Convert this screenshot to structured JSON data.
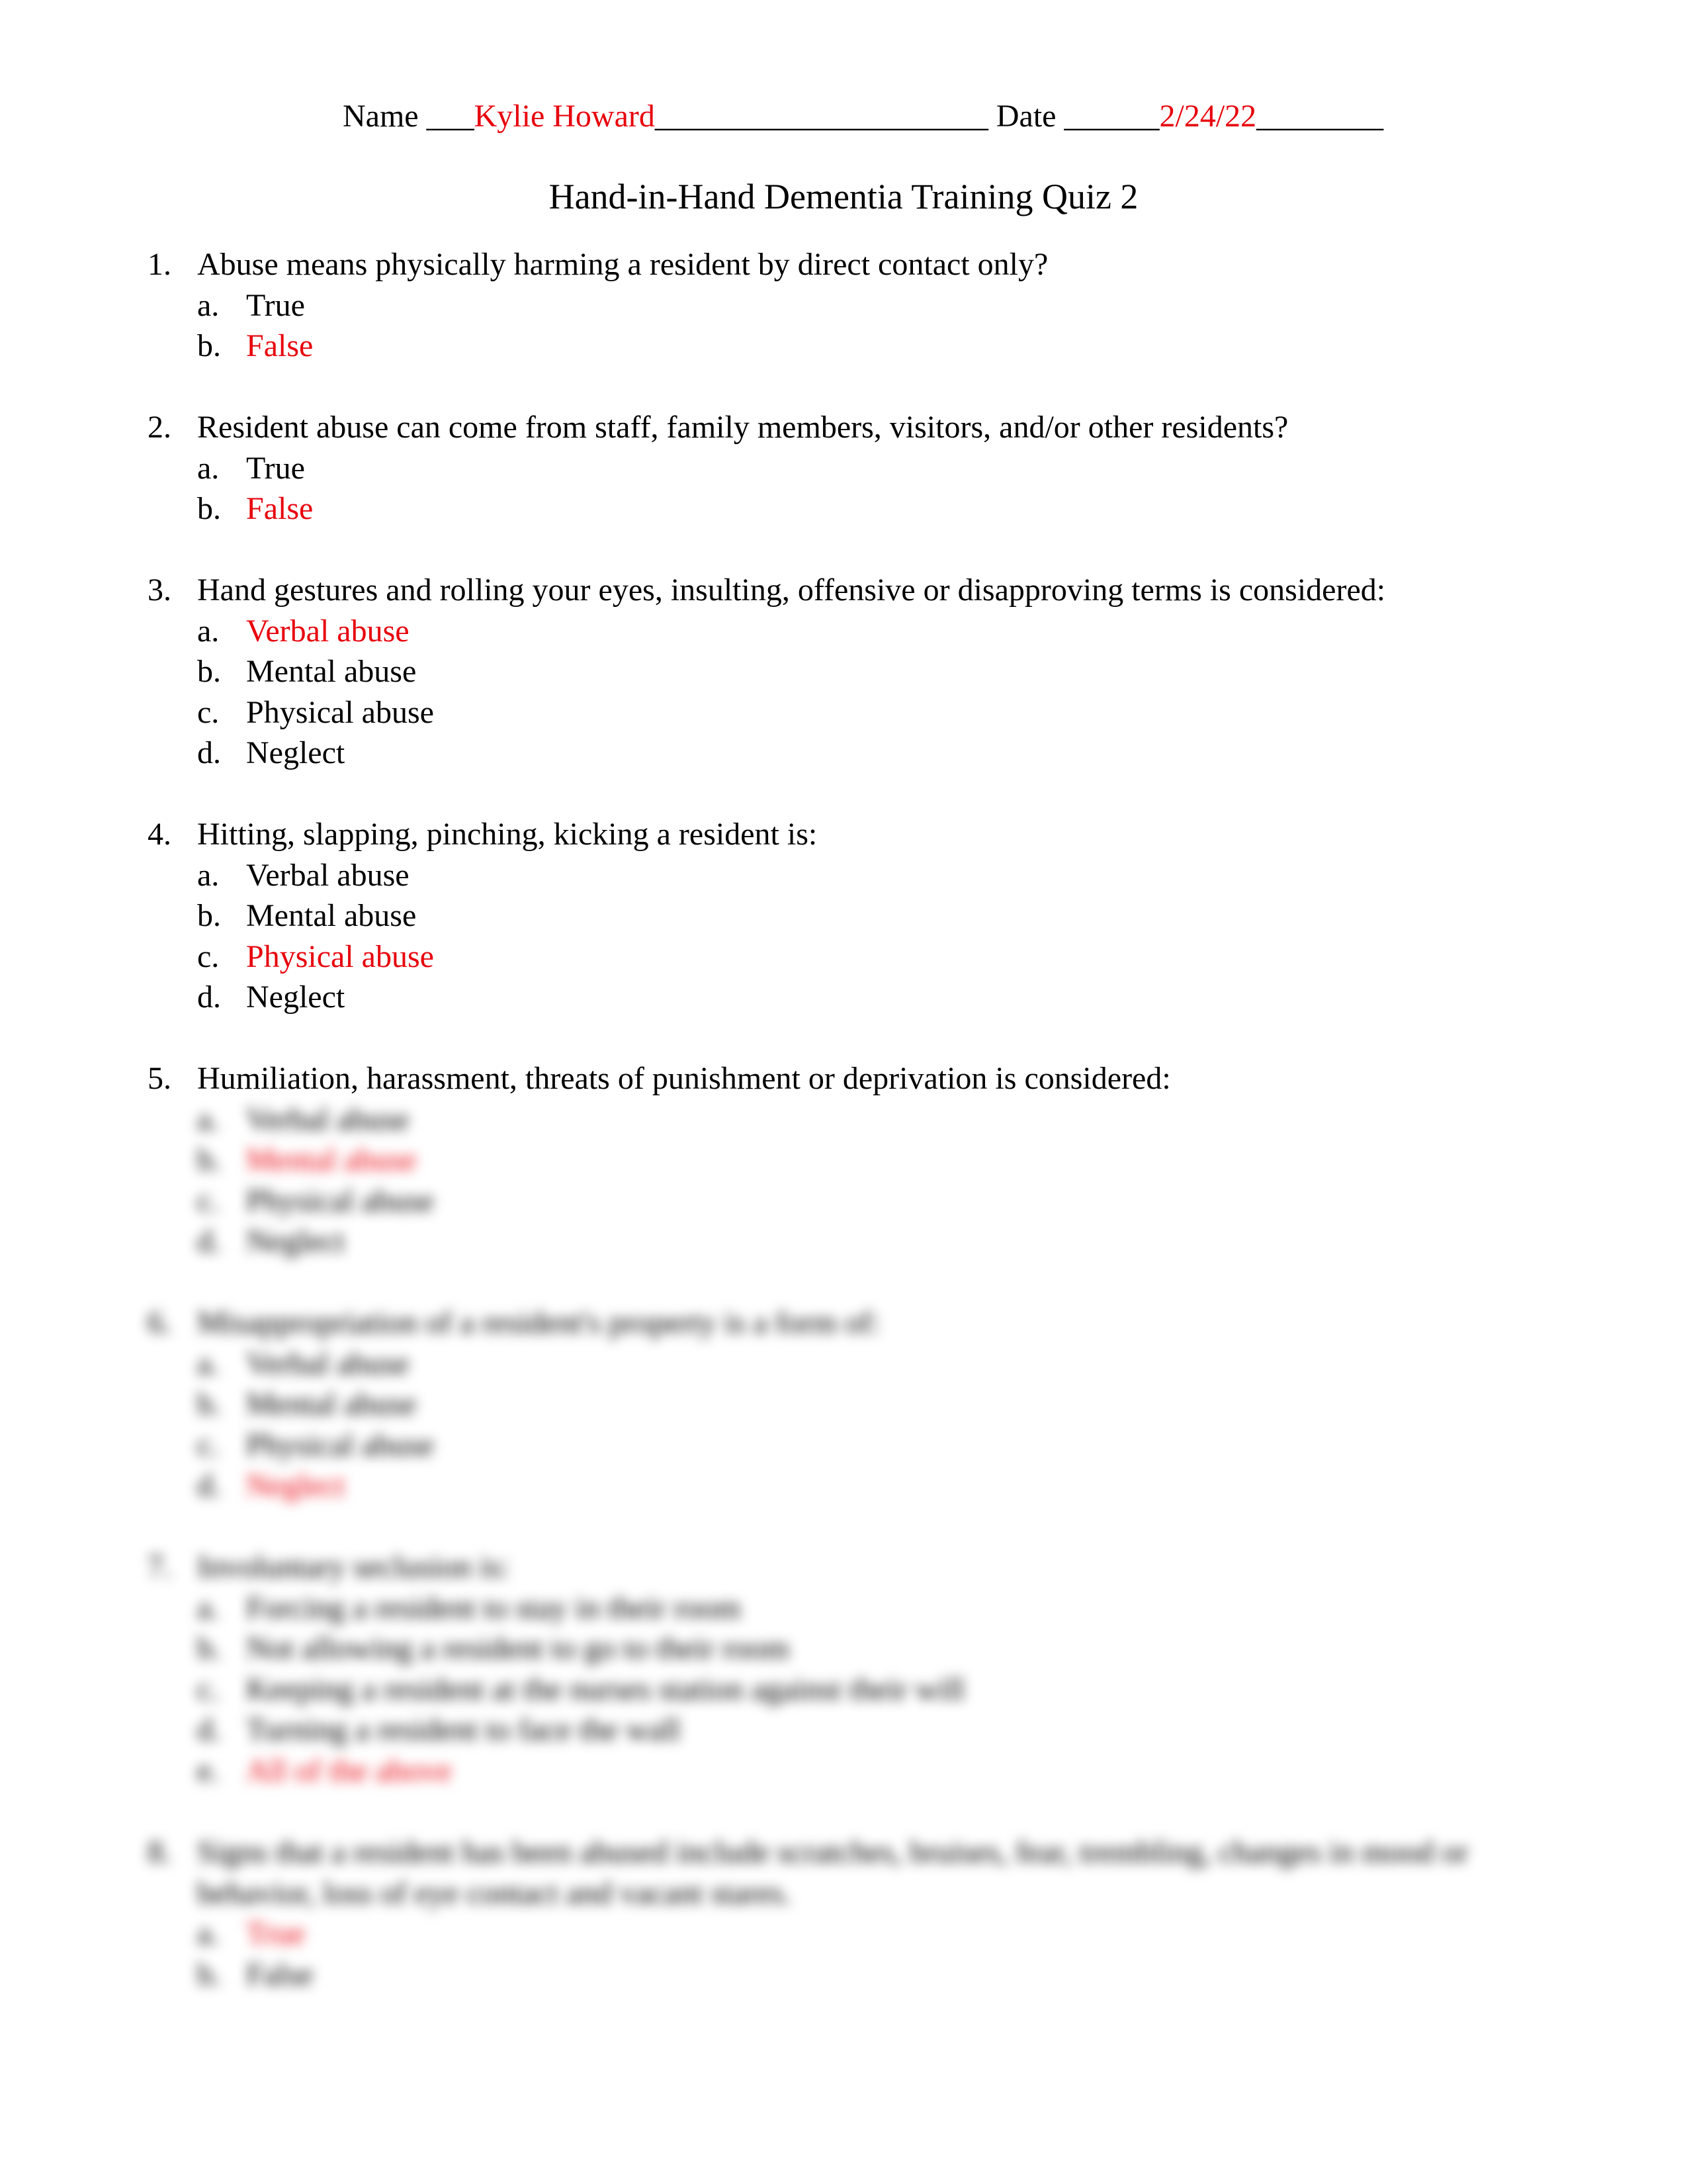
{
  "header": {
    "name_label": "Name ___",
    "name_value": "Kylie Howard",
    "name_trailing": "_____________________",
    "date_label": " Date ______",
    "date_value": "2/24/22",
    "date_trailing": "________"
  },
  "title": "Hand-in-Hand Dementia Training Quiz 2",
  "colors": {
    "answer": "#e8000b",
    "text": "#000000"
  },
  "questions": [
    {
      "number": "1.",
      "text": "Abuse means physically harming a resident by direct contact only?",
      "options": [
        {
          "letter": "a.",
          "text": "True",
          "marked": false
        },
        {
          "letter": "b.",
          "text": "False",
          "marked": true
        }
      ]
    },
    {
      "number": "2.",
      "text": "Resident abuse can come from staff, family members, visitors, and/or other residents?",
      "options": [
        {
          "letter": "a.",
          "text": "True",
          "marked": false
        },
        {
          "letter": "b.",
          "text": "False",
          "marked": true
        }
      ]
    },
    {
      "number": "3.",
      "text": "Hand gestures and rolling your eyes, insulting, offensive or disapproving terms is considered:",
      "options": [
        {
          "letter": "a.",
          "text": "Verbal abuse",
          "marked": true
        },
        {
          "letter": "b.",
          "text": "Mental abuse",
          "marked": false
        },
        {
          "letter": "c.",
          "text": "Physical abuse",
          "marked": false
        },
        {
          "letter": "d.",
          "text": "Neglect",
          "marked": false
        }
      ]
    },
    {
      "number": "4.",
      "text": "Hitting, slapping, pinching, kicking a resident is:",
      "options": [
        {
          "letter": "a.",
          "text": "Verbal abuse",
          "marked": false
        },
        {
          "letter": "b.",
          "text": "Mental abuse",
          "marked": false
        },
        {
          "letter": "c.",
          "text": "Physical abuse",
          "marked": true
        },
        {
          "letter": "d.",
          "text": "Neglect",
          "marked": false
        }
      ]
    },
    {
      "number": "5.",
      "text": "Humiliation, harassment, threats of punishment or deprivation is considered:",
      "options": [
        {
          "letter": "a.",
          "text": "Verbal abuse",
          "marked": false
        },
        {
          "letter": "b.",
          "text": "Mental abuse",
          "marked": true
        },
        {
          "letter": "c.",
          "text": "Physical abuse",
          "marked": false
        },
        {
          "letter": "d.",
          "text": "Neglect",
          "marked": false
        }
      ]
    },
    {
      "number": "6.",
      "text": "Misappropriation of a resident's property is a form of:",
      "options": [
        {
          "letter": "a.",
          "text": "Verbal abuse",
          "marked": false
        },
        {
          "letter": "b.",
          "text": "Mental abuse",
          "marked": false
        },
        {
          "letter": "c.",
          "text": "Physical abuse",
          "marked": false
        },
        {
          "letter": "d.",
          "text": "Neglect",
          "marked": true
        }
      ]
    },
    {
      "number": "7.",
      "text": "Involuntary seclusion is:",
      "options": [
        {
          "letter": "a.",
          "text": "Forcing a resident to stay in their room",
          "marked": false
        },
        {
          "letter": "b.",
          "text": "Not allowing a resident to go to their room",
          "marked": false
        },
        {
          "letter": "c.",
          "text": "Keeping a resident at the nurses station against their will",
          "marked": false
        },
        {
          "letter": "d.",
          "text": "Turning a resident to face the wall",
          "marked": false
        },
        {
          "letter": "e.",
          "text": "All of the above",
          "marked": true
        }
      ]
    },
    {
      "number": "8.",
      "text": "Signs that a resident has been abused include scratches, bruises, fear, trembling, changes in mood or behavior, loss of eye contact and vacant stares.",
      "options": [
        {
          "letter": "a.",
          "text": "True",
          "marked": true
        },
        {
          "letter": "b.",
          "text": "False",
          "marked": false
        }
      ]
    }
  ]
}
